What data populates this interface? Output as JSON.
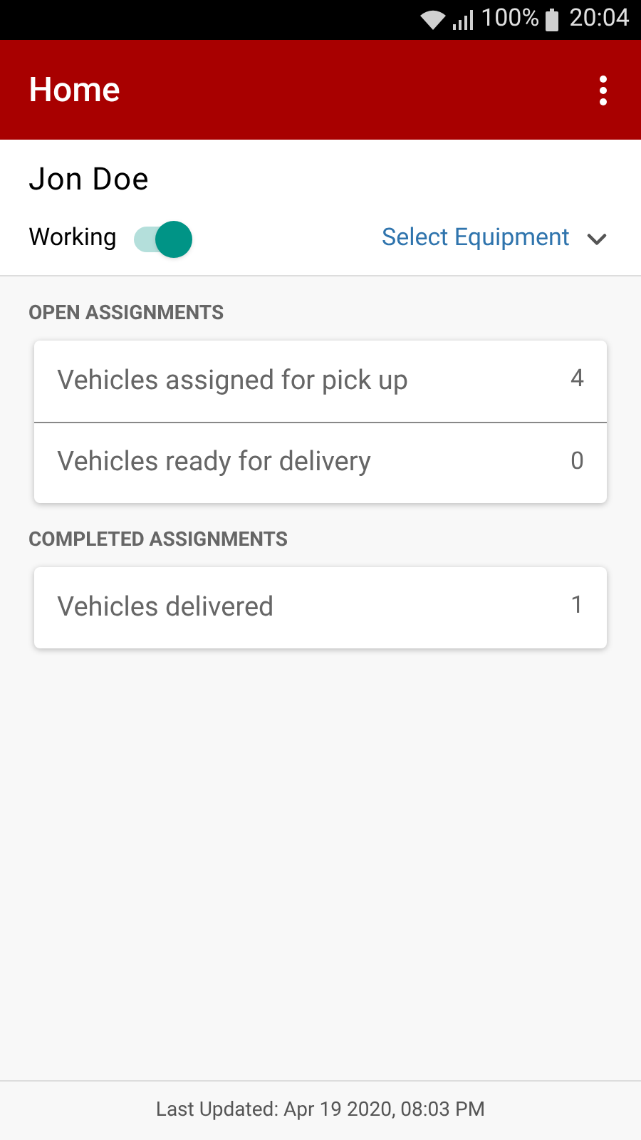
{
  "status_bar": {
    "battery": "100%",
    "time": "20:04"
  },
  "app_bar": {
    "title": "Home"
  },
  "user": {
    "name": "Jon Doe",
    "working": {
      "label": "Working",
      "on": true
    },
    "equipment": {
      "label": "Select Equipment"
    }
  },
  "sections": [
    {
      "title": "OPEN ASSIGNMENTS",
      "rows": [
        {
          "label": "Vehicles assigned for pick up",
          "count": "4"
        },
        {
          "label": "Vehicles ready for delivery",
          "count": "0"
        }
      ]
    },
    {
      "title": "COMPLETED ASSIGNMENTS",
      "rows": [
        {
          "label": "Vehicles delivered",
          "count": "1"
        }
      ]
    }
  ],
  "footer": {
    "text": "Last Updated: Apr 19 2020, 08:03 PM"
  }
}
